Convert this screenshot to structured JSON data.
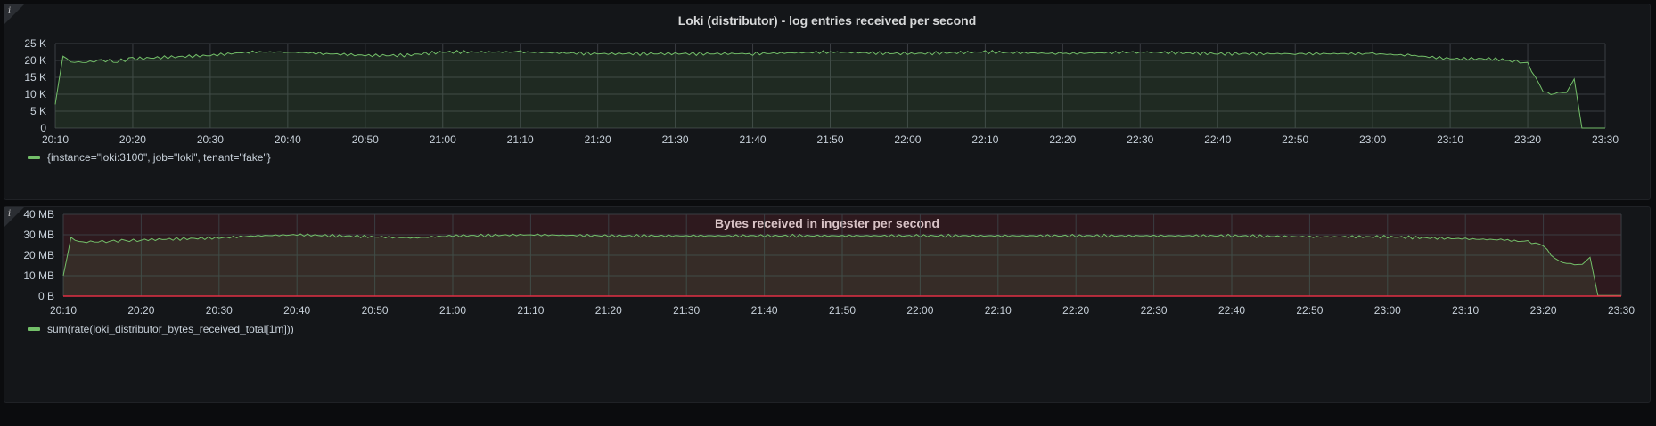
{
  "colors": {
    "series": "#73bf69",
    "threshold_line": "#e02f44",
    "grid": "#3a3d42",
    "fill": "#73bf69",
    "threshold_fill": "#e02f44"
  },
  "panels": [
    {
      "info_icon": "info-icon",
      "title": "Loki (distributor) - log entries received per second",
      "legend": "{instance=\"loki:3100\", job=\"loki\", tenant=\"fake\"}"
    },
    {
      "info_icon": "info-icon",
      "title": "Bytes received in ingester per second",
      "legend": "sum(rate(loki_distributor_bytes_received_total[1m]))"
    }
  ],
  "chart_data": [
    {
      "type": "area",
      "title": "Loki (distributor) - log entries received per second",
      "x_tick_labels": [
        "20:10",
        "20:20",
        "20:30",
        "20:40",
        "20:50",
        "21:00",
        "21:10",
        "21:20",
        "21:30",
        "21:40",
        "21:50",
        "22:00",
        "22:10",
        "22:20",
        "22:30",
        "22:40",
        "22:50",
        "23:00",
        "23:10",
        "23:20",
        "23:30"
      ],
      "y_tick_labels": [
        "0",
        "5 K",
        "10 K",
        "15 K",
        "20 K",
        "25 K"
      ],
      "ylim": [
        0,
        25000
      ],
      "xlim": [
        "20:10",
        "23:30"
      ],
      "grid": true,
      "legend_position": "bottom-left",
      "series": [
        {
          "name": "{instance=\"loki:3100\", job=\"loki\", tenant=\"fake\"}",
          "x": [
            "20:10",
            "20:11",
            "20:12",
            "20:14",
            "20:16",
            "20:18",
            "20:20",
            "20:25",
            "20:30",
            "20:35",
            "20:40",
            "20:45",
            "20:50",
            "20:55",
            "21:00",
            "21:10",
            "21:20",
            "21:30",
            "21:40",
            "21:50",
            "22:00",
            "22:10",
            "22:20",
            "22:30",
            "22:40",
            "22:50",
            "23:00",
            "23:05",
            "23:10",
            "23:15",
            "23:18",
            "23:20",
            "23:21",
            "23:22",
            "23:23",
            "23:24",
            "23:25",
            "23:26",
            "23:27",
            "23:30"
          ],
          "y": [
            7000,
            21500,
            19500,
            19500,
            20000,
            19800,
            20500,
            21000,
            21500,
            22500,
            22500,
            22000,
            21500,
            21500,
            22500,
            22500,
            22000,
            22000,
            22000,
            22500,
            22000,
            22500,
            22000,
            22500,
            22000,
            22000,
            22000,
            21500,
            20500,
            20500,
            20000,
            19000,
            15000,
            11000,
            10000,
            10500,
            10500,
            14500,
            0,
            0
          ]
        }
      ]
    },
    {
      "type": "area",
      "title": "Bytes received in ingester per second",
      "x_tick_labels": [
        "20:10",
        "20:20",
        "20:30",
        "20:40",
        "20:50",
        "21:00",
        "21:10",
        "21:20",
        "21:30",
        "21:40",
        "21:50",
        "22:00",
        "22:10",
        "22:20",
        "22:30",
        "22:40",
        "22:50",
        "23:00",
        "23:10",
        "23:20",
        "23:30"
      ],
      "y_tick_labels": [
        "0 B",
        "10 MB",
        "20 MB",
        "30 MB",
        "40 MB"
      ],
      "ylim": [
        0,
        40
      ],
      "y_unit": "MB",
      "xlim": [
        "20:10",
        "23:30"
      ],
      "grid": true,
      "threshold": 0,
      "legend_position": "bottom-left",
      "series": [
        {
          "name": "sum(rate(loki_distributor_bytes_received_total[1m]))",
          "x": [
            "20:10",
            "20:11",
            "20:12",
            "20:14",
            "20:16",
            "20:18",
            "20:20",
            "20:25",
            "20:30",
            "20:35",
            "20:40",
            "20:45",
            "20:50",
            "20:55",
            "21:00",
            "21:10",
            "21:20",
            "21:30",
            "21:40",
            "21:50",
            "22:00",
            "22:10",
            "22:20",
            "22:30",
            "22:40",
            "22:50",
            "23:00",
            "23:05",
            "23:10",
            "23:15",
            "23:18",
            "23:20",
            "23:21",
            "23:22",
            "23:23",
            "23:24",
            "23:25",
            "23:26",
            "23:27",
            "23:30"
          ],
          "y": [
            10,
            28.5,
            26.5,
            26.5,
            27,
            27,
            27.5,
            28,
            28.5,
            29.5,
            30,
            29.5,
            29,
            28.5,
            29.5,
            30,
            29.5,
            29.5,
            29.5,
            29.5,
            29.5,
            29.5,
            29.5,
            29.5,
            29.5,
            29,
            29,
            28.5,
            28,
            27.5,
            26.5,
            25,
            20,
            17,
            16,
            15.5,
            15.5,
            19,
            0.3,
            0.3
          ]
        }
      ]
    }
  ]
}
